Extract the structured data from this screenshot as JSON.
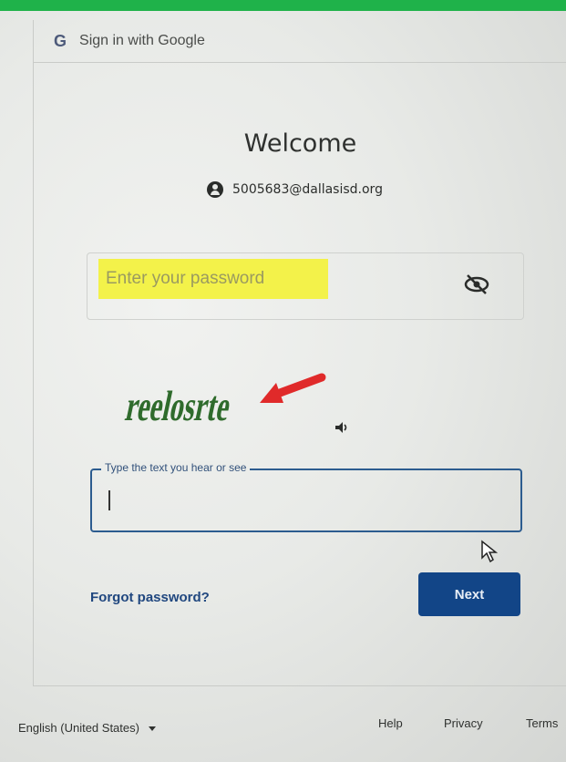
{
  "header": {
    "logo": "G",
    "title": "Sign in with Google"
  },
  "main": {
    "welcome": "Welcome",
    "account_email": "5005683@dallasisd.org",
    "password_placeholder": "Enter your password",
    "captcha_text": "reelosrte",
    "captcha_field_label": "Type the text you hear or see",
    "captcha_field_value": "",
    "forgot_password": "Forgot password?",
    "next_button": "Next"
  },
  "footer": {
    "language": "English (United States)",
    "help": "Help",
    "privacy": "Privacy",
    "terms": "Terms"
  },
  "icons": {
    "account": "account-circle-icon",
    "visibility": "eye-off-icon",
    "audio": "speaker-icon",
    "arrow": "red-arrow-annotation",
    "cursor": "mouse-cursor-icon"
  },
  "colors": {
    "top_bar": "#1fb24a",
    "highlight": "#f3f24a",
    "next_button": "#124587",
    "link": "#20477f",
    "focus_border": "#2c5c8f",
    "captcha": "#2f6b2c",
    "arrow": "#e02a2a"
  }
}
